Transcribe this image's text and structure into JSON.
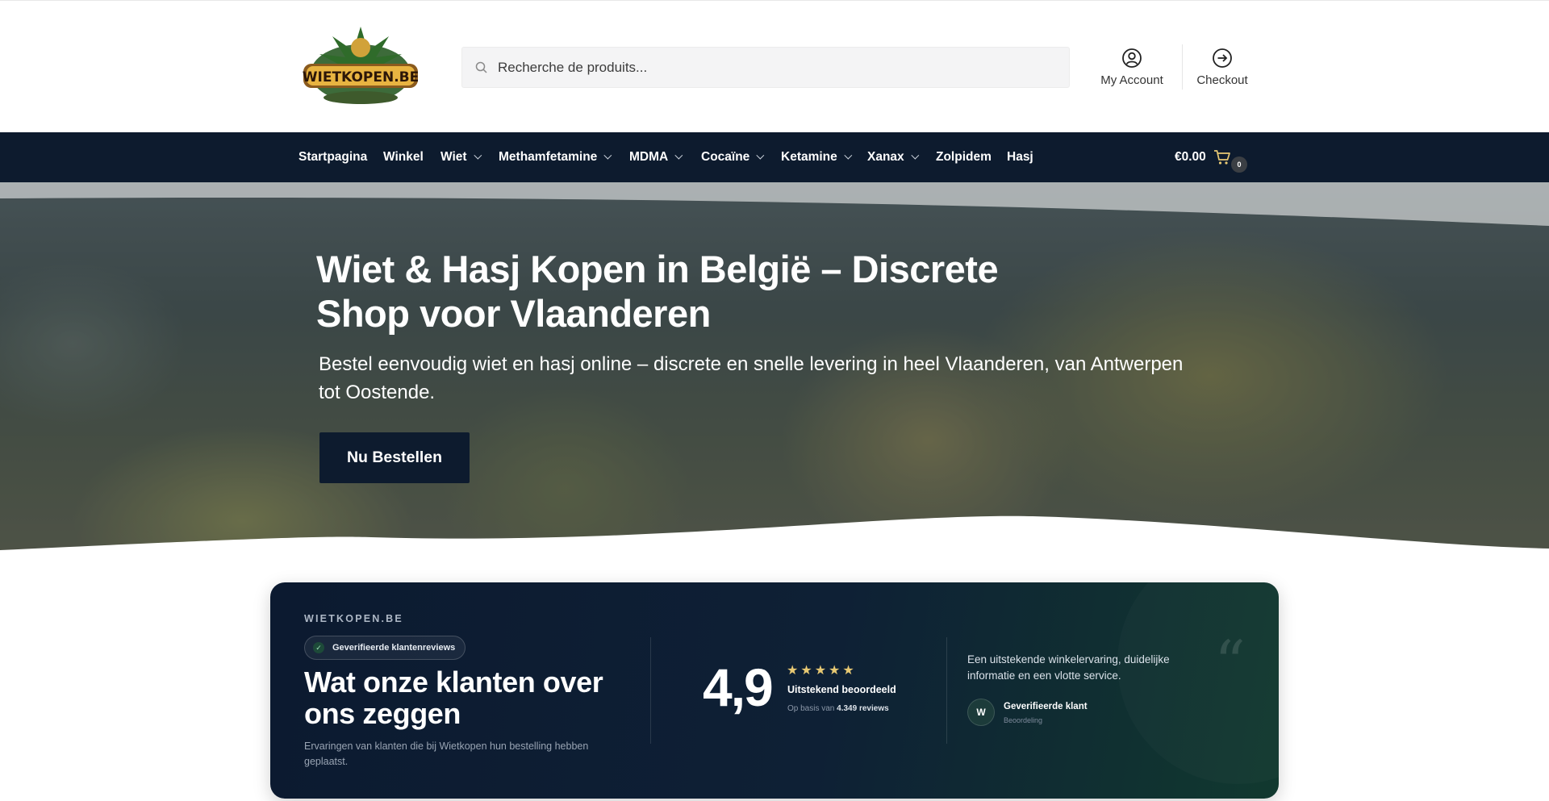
{
  "brand": {
    "logo_text": "WIETKOPEN.BE"
  },
  "search": {
    "placeholder": "Recherche de produits..."
  },
  "header_links": {
    "account": "My Account",
    "checkout": "Checkout"
  },
  "nav": {
    "items": [
      {
        "label": "Startpagina",
        "dropdown": false
      },
      {
        "label": "Winkel",
        "dropdown": false
      },
      {
        "label": "Wiet",
        "dropdown": true
      },
      {
        "label": "Methamfetamine",
        "dropdown": true
      },
      {
        "label": "MDMA",
        "dropdown": true
      },
      {
        "label": "Cocaïne",
        "dropdown": true
      },
      {
        "label": "Ketamine",
        "dropdown": true
      },
      {
        "label": "Xanax",
        "dropdown": true
      },
      {
        "label": "Zolpidem",
        "dropdown": false
      },
      {
        "label": "Hasj",
        "dropdown": false
      }
    ],
    "cart_total": "€0.00",
    "cart_count": "0"
  },
  "hero": {
    "title": "Wiet & Hasj Kopen in België – Discrete Shop voor Vlaanderen",
    "subtitle": "Bestel eenvoudig wiet en hasj online – discrete en snelle levering in heel Vlaanderen, van Antwerpen tot Oostende.",
    "button": "Nu Bestellen"
  },
  "reviews": {
    "brand": "WIETKOPEN.BE",
    "badge": "Geverifieerde klantenreviews",
    "badge_icon": "check-icon",
    "title": "Wat onze klanten over ons zeggen",
    "description": "Ervaringen van klanten die bij Wietkopen hun bestelling hebben geplaatst.",
    "score": "4,9",
    "stars": "★★★★★",
    "rating_label": "Uitstekend beoordeeld",
    "based_prefix": "Op basis van",
    "based_count": "4.349 reviews",
    "quote": "Een uitstekende winkelervaring, duidelijke informatie en een vlotte service.",
    "quote_mark": "“",
    "avatar_initial": "W",
    "reviewer": "Geverifieerde klant",
    "reviewer_role": "Beoordeling"
  },
  "colors": {
    "navy": "#0d1b2e",
    "star": "#e7c873",
    "green_dark": "#11392f"
  }
}
